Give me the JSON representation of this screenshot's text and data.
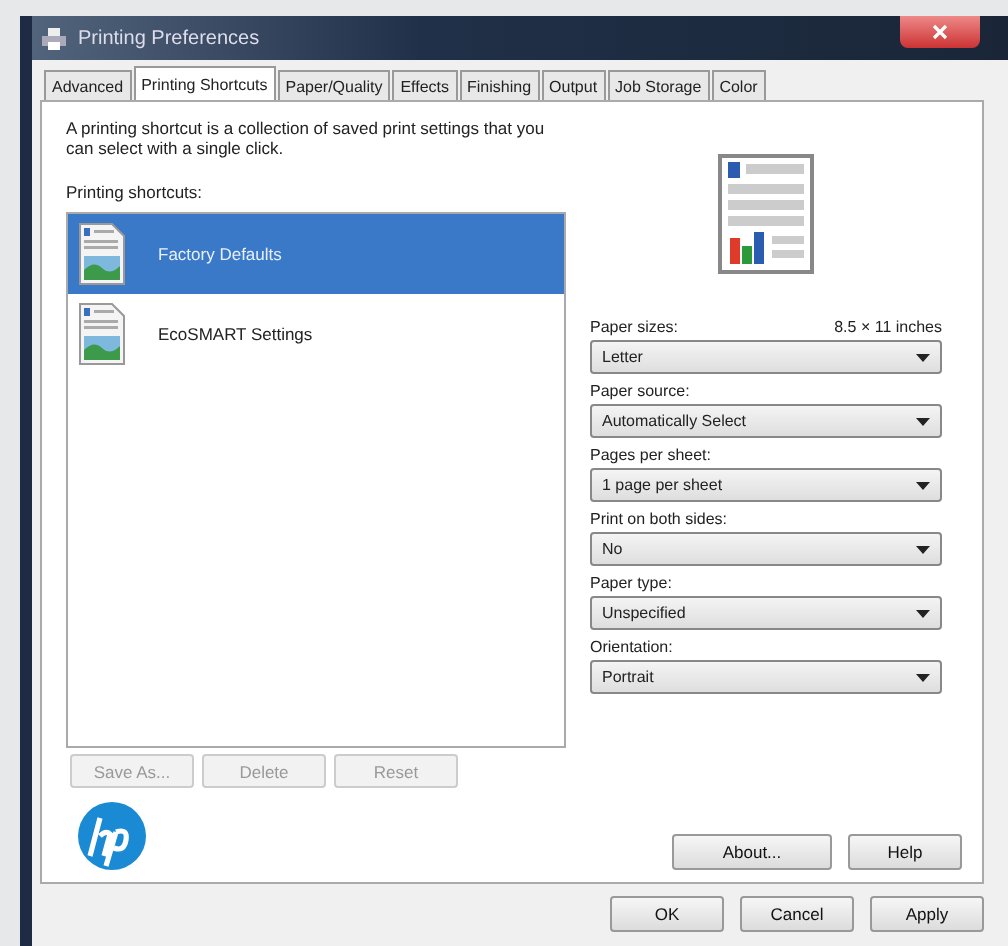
{
  "window": {
    "title": "Printing Preferences"
  },
  "tabs": [
    {
      "label": "Advanced",
      "selected": false
    },
    {
      "label": "Printing Shortcuts",
      "selected": true
    },
    {
      "label": "Paper/Quality",
      "selected": false
    },
    {
      "label": "Effects",
      "selected": false
    },
    {
      "label": "Finishing",
      "selected": false
    },
    {
      "label": "Output",
      "selected": false
    },
    {
      "label": "Job Storage",
      "selected": false
    },
    {
      "label": "Color",
      "selected": false
    }
  ],
  "description": "A printing shortcut is a collection of saved print settings that you can select with a single click.",
  "shortcuts_label": "Printing shortcuts:",
  "shortcuts": [
    {
      "label": "Factory Defaults",
      "selected": true
    },
    {
      "label": "EcoSMART Settings",
      "selected": false
    }
  ],
  "shortcut_buttons": [
    {
      "label": "Save As...",
      "disabled": true
    },
    {
      "label": "Delete",
      "disabled": true
    },
    {
      "label": "Reset",
      "disabled": true
    }
  ],
  "settings": [
    {
      "label": "Paper sizes:",
      "note": "8.5 × 11 inches",
      "value": "Letter"
    },
    {
      "label": "Paper source:",
      "value": "Automatically Select"
    },
    {
      "label": "Pages per sheet:",
      "value": "1 page per sheet"
    },
    {
      "label": "Print on both sides:",
      "value": "No"
    },
    {
      "label": "Paper type:",
      "value": "Unspecified"
    },
    {
      "label": "Orientation:",
      "value": "Portrait"
    }
  ],
  "panel_buttons": [
    {
      "label": "About...",
      "disabled": false
    },
    {
      "label": "Help",
      "disabled": false
    }
  ],
  "dialog_buttons": [
    {
      "label": "OK",
      "disabled": false
    },
    {
      "label": "Cancel",
      "disabled": false
    },
    {
      "label": "Apply",
      "disabled": false
    }
  ]
}
